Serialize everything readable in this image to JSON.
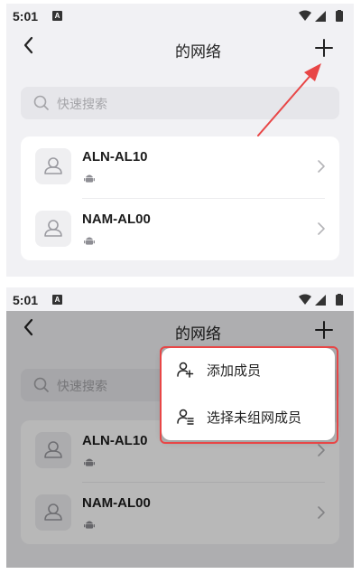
{
  "top_panel": {
    "status": {
      "time": "5:01",
      "notification": "A"
    },
    "header": {
      "title": "的网络"
    },
    "search": {
      "placeholder": "快速搜索"
    },
    "devices": [
      {
        "name": "ALN-AL10"
      },
      {
        "name": "NAM-AL00"
      }
    ]
  },
  "bottom_panel": {
    "status": {
      "time": "5:01",
      "notification": "A"
    },
    "header": {
      "title": "的网络"
    },
    "search": {
      "placeholder": "快速搜索"
    },
    "devices": [
      {
        "name": "ALN-AL10"
      },
      {
        "name": "NAM-AL00"
      }
    ],
    "menu": {
      "items": [
        {
          "label": "添加成员",
          "icon": "add-person-icon"
        },
        {
          "label": "选择未组网成员",
          "icon": "person-select-icon"
        }
      ]
    }
  },
  "colors": {
    "annotation": "#e84646",
    "overlay": "rgba(0,0,0,0.28)"
  }
}
